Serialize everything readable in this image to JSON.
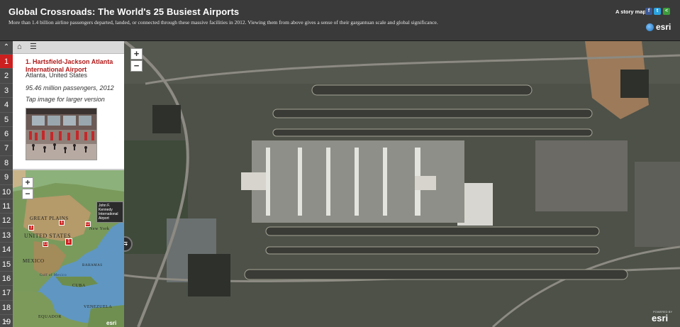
{
  "header": {
    "title": "Global Crossroads: The World's 25 Busiest Airports",
    "subtitle": "More than 1.4 billion airline passengers departed, landed, or connected through these massive facilities in 2012. Viewing them from above gives a sense of their gargantuan scale and global significance.",
    "storymap_label": "A story map",
    "logo_text": "esri"
  },
  "nav": {
    "up_icon": "chevron-up-icon",
    "down_icon": "chevron-down-icon",
    "items": [
      "1",
      "2",
      "3",
      "4",
      "5",
      "6",
      "7",
      "8",
      "9",
      "10",
      "11",
      "12",
      "13",
      "14",
      "15",
      "16",
      "17",
      "18",
      "19"
    ],
    "active_index": 0
  },
  "entry": {
    "title": "1. Hartsfield-Jackson Atlanta International Airport",
    "location": "Atlanta, United States",
    "passengers": "95.46 million passengers, 2012",
    "tap_hint": "Tap image for larger version"
  },
  "inset_map": {
    "zoom_in": "+",
    "zoom_out": "−",
    "tooltip": "John F. Kennedy International Airport",
    "labels": [
      "GREAT PLAINS",
      "UNITED STATES",
      "New York",
      "MEXICO",
      "Gulf of Mexico",
      "BAHAMAS",
      "CUBA",
      "VENEZUELA",
      "EQUADOR"
    ],
    "attribution": "esri",
    "markers": [
      "3",
      "6",
      "1",
      "11",
      "12"
    ]
  },
  "main_map": {
    "zoom_in": "+",
    "zoom_out": "−",
    "swap_icon": "swap-arrows-icon",
    "logo": "esri",
    "powered": "POWERED BY"
  },
  "colors": {
    "accent": "#cc1f1f",
    "header_bg": "#3a3a3a",
    "title_red": "#b01818"
  }
}
